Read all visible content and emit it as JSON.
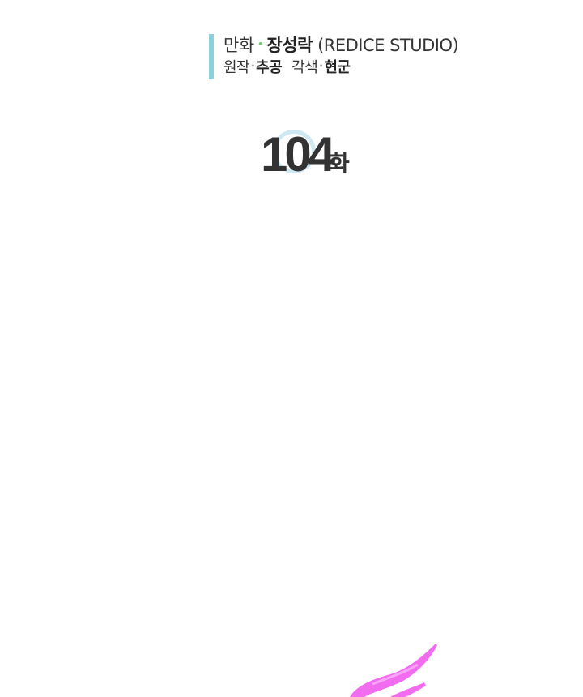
{
  "credits": {
    "line1": {
      "role": "만화",
      "name": "장성락",
      "studio": "(REDICE STUDIO)"
    },
    "line2": {
      "original_role": "원작",
      "original_name": "추공",
      "adapt_role": "각색",
      "adapt_name": "현군"
    }
  },
  "episode": {
    "number": "104",
    "suffix": "화"
  },
  "colors": {
    "accent_bar": "#8ccfdd",
    "dot_green": "#7cc576",
    "ring": "#cfe9f2",
    "text": "#333333",
    "brush": "#f26cf0"
  }
}
